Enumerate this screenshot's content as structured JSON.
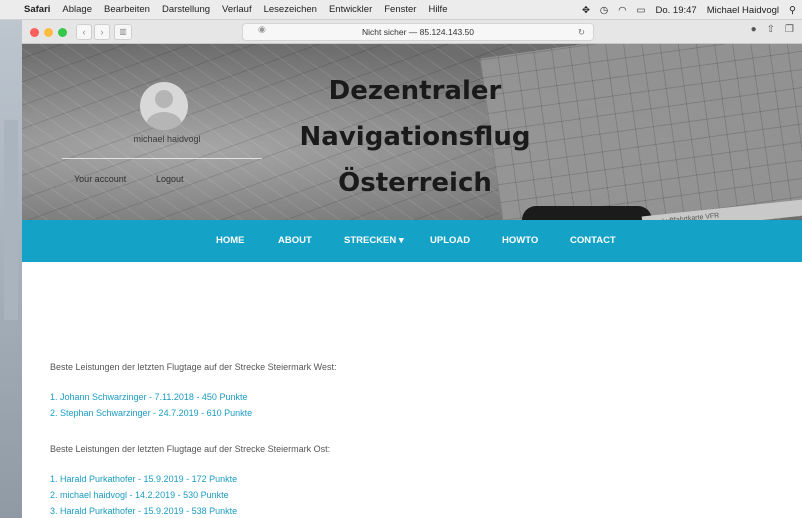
{
  "menubar": {
    "app": "Safari",
    "items": [
      "Ablage",
      "Bearbeiten",
      "Darstellung",
      "Verlauf",
      "Lesezeichen",
      "Entwickler",
      "Fenster",
      "Hilfe"
    ],
    "clock": "Do. 19:47",
    "user": "Michael Haidvogl"
  },
  "browser": {
    "address": "Nicht sicher — 85.124.143.50"
  },
  "hero": {
    "username": "michael haidvogl",
    "account_link": "Your account",
    "logout_link": "Logout",
    "title_lines": [
      "Dezentraler",
      "Navigationsflug",
      "Österreich"
    ],
    "map_strip_text": "Luftfahrtkarte VFR"
  },
  "nav": {
    "items": [
      "HOME",
      "ABOUT",
      "STRECKEN ▾",
      "UPLOAD",
      "HOWTO",
      "CONTACT"
    ]
  },
  "content": {
    "west_heading": "Beste Leistungen der letzten Flugtage auf der Strecke Steiermark West:",
    "west_entries": [
      "1. Johann Schwarzinger - 7.11.2018 - 450 Punkte",
      "2. Stephan Schwarzinger - 24.7.2019 - 610 Punkte"
    ],
    "ost_heading": "Beste Leistungen der letzten Flugtage auf der Strecke Steiermark Ost:",
    "ost_entries": [
      "1. Harald Purkathofer - 15.9.2019 - 172 Punkte",
      "2. michael haidvogl - 14.2.2019 - 530 Punkte",
      "3. Harald Purkathofer - 15.9.2019 - 538 Punkte"
    ]
  }
}
